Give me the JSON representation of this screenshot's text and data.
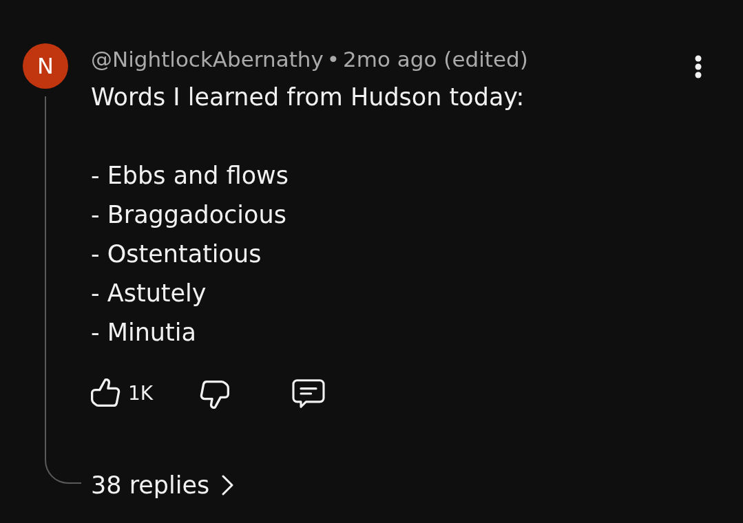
{
  "comment": {
    "avatar_initial": "N",
    "author": "@NightlockAbernathy",
    "separator": "•",
    "time": "2mo ago (edited)",
    "body": "Words I learned from Hudson today:\n\n- Ebbs and flows\n- Braggadocious\n- Ostentatious\n- Astutely\n- Minutia",
    "actions": {
      "like_count": "1K",
      "liked": false,
      "disliked": false
    },
    "replies": "38 replies"
  }
}
